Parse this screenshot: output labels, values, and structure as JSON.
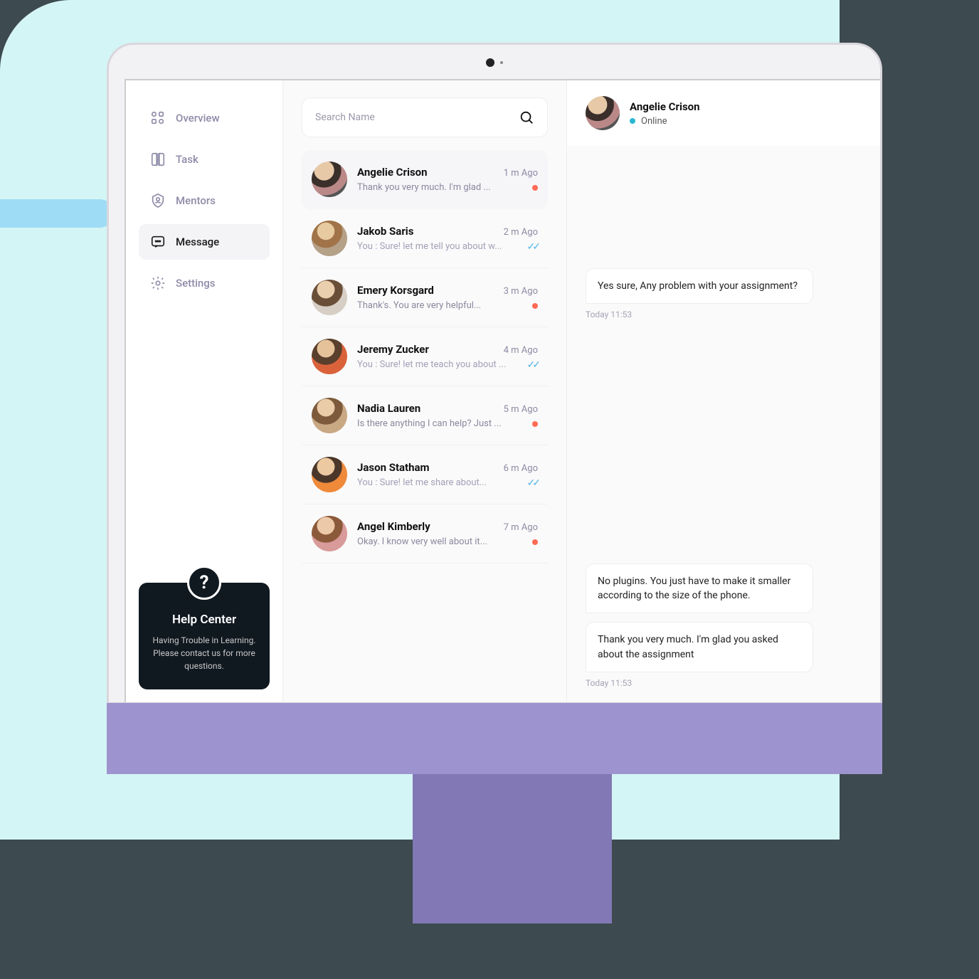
{
  "sidebar": {
    "items": [
      {
        "label": "Overview"
      },
      {
        "label": "Task"
      },
      {
        "label": "Mentors"
      },
      {
        "label": "Message"
      },
      {
        "label": "Settings"
      }
    ],
    "help": {
      "title": "Help Center",
      "desc": "Having Trouble in Learning. Please contact us for more questions.",
      "badge": "?"
    }
  },
  "search": {
    "placeholder": "Search Name"
  },
  "contacts": [
    {
      "name": "Angelie Crison",
      "time": "1 m Ago",
      "preview": "Thank you very much. I'm glad ...",
      "status": "unread",
      "selected": true
    },
    {
      "name": "Jakob Saris",
      "time": "2 m Ago",
      "preview": "You : Sure! let me tell you about w...",
      "status": "read",
      "selected": false
    },
    {
      "name": "Emery Korsgard",
      "time": "3 m Ago",
      "preview": "Thank's. You are very helpful...",
      "status": "unread",
      "selected": false
    },
    {
      "name": "Jeremy Zucker",
      "time": "4 m Ago",
      "preview": "You : Sure! let me teach you about ...",
      "status": "read",
      "selected": false
    },
    {
      "name": "Nadia Lauren",
      "time": "5 m Ago",
      "preview": "Is there anything I can help? Just ...",
      "status": "unread",
      "selected": false
    },
    {
      "name": "Jason Statham",
      "time": "6 m Ago",
      "preview": "You : Sure! let me share about...",
      "status": "read",
      "selected": false
    },
    {
      "name": "Angel Kimberly",
      "time": "7 m Ago",
      "preview": "Okay. I know very well about it...",
      "status": "unread",
      "selected": false
    }
  ],
  "chat": {
    "header": {
      "name": "Angelie Crison",
      "status": "Online"
    },
    "messages": [
      {
        "text": "Yes sure, Any problem with your assignment?",
        "time": "Today 11:53"
      },
      {
        "text": "No plugins. You just have to make it smaller according to the size of the phone."
      },
      {
        "text": "Thank you very much. I'm glad you asked about the assignment",
        "time": "Today 11:53"
      }
    ]
  }
}
